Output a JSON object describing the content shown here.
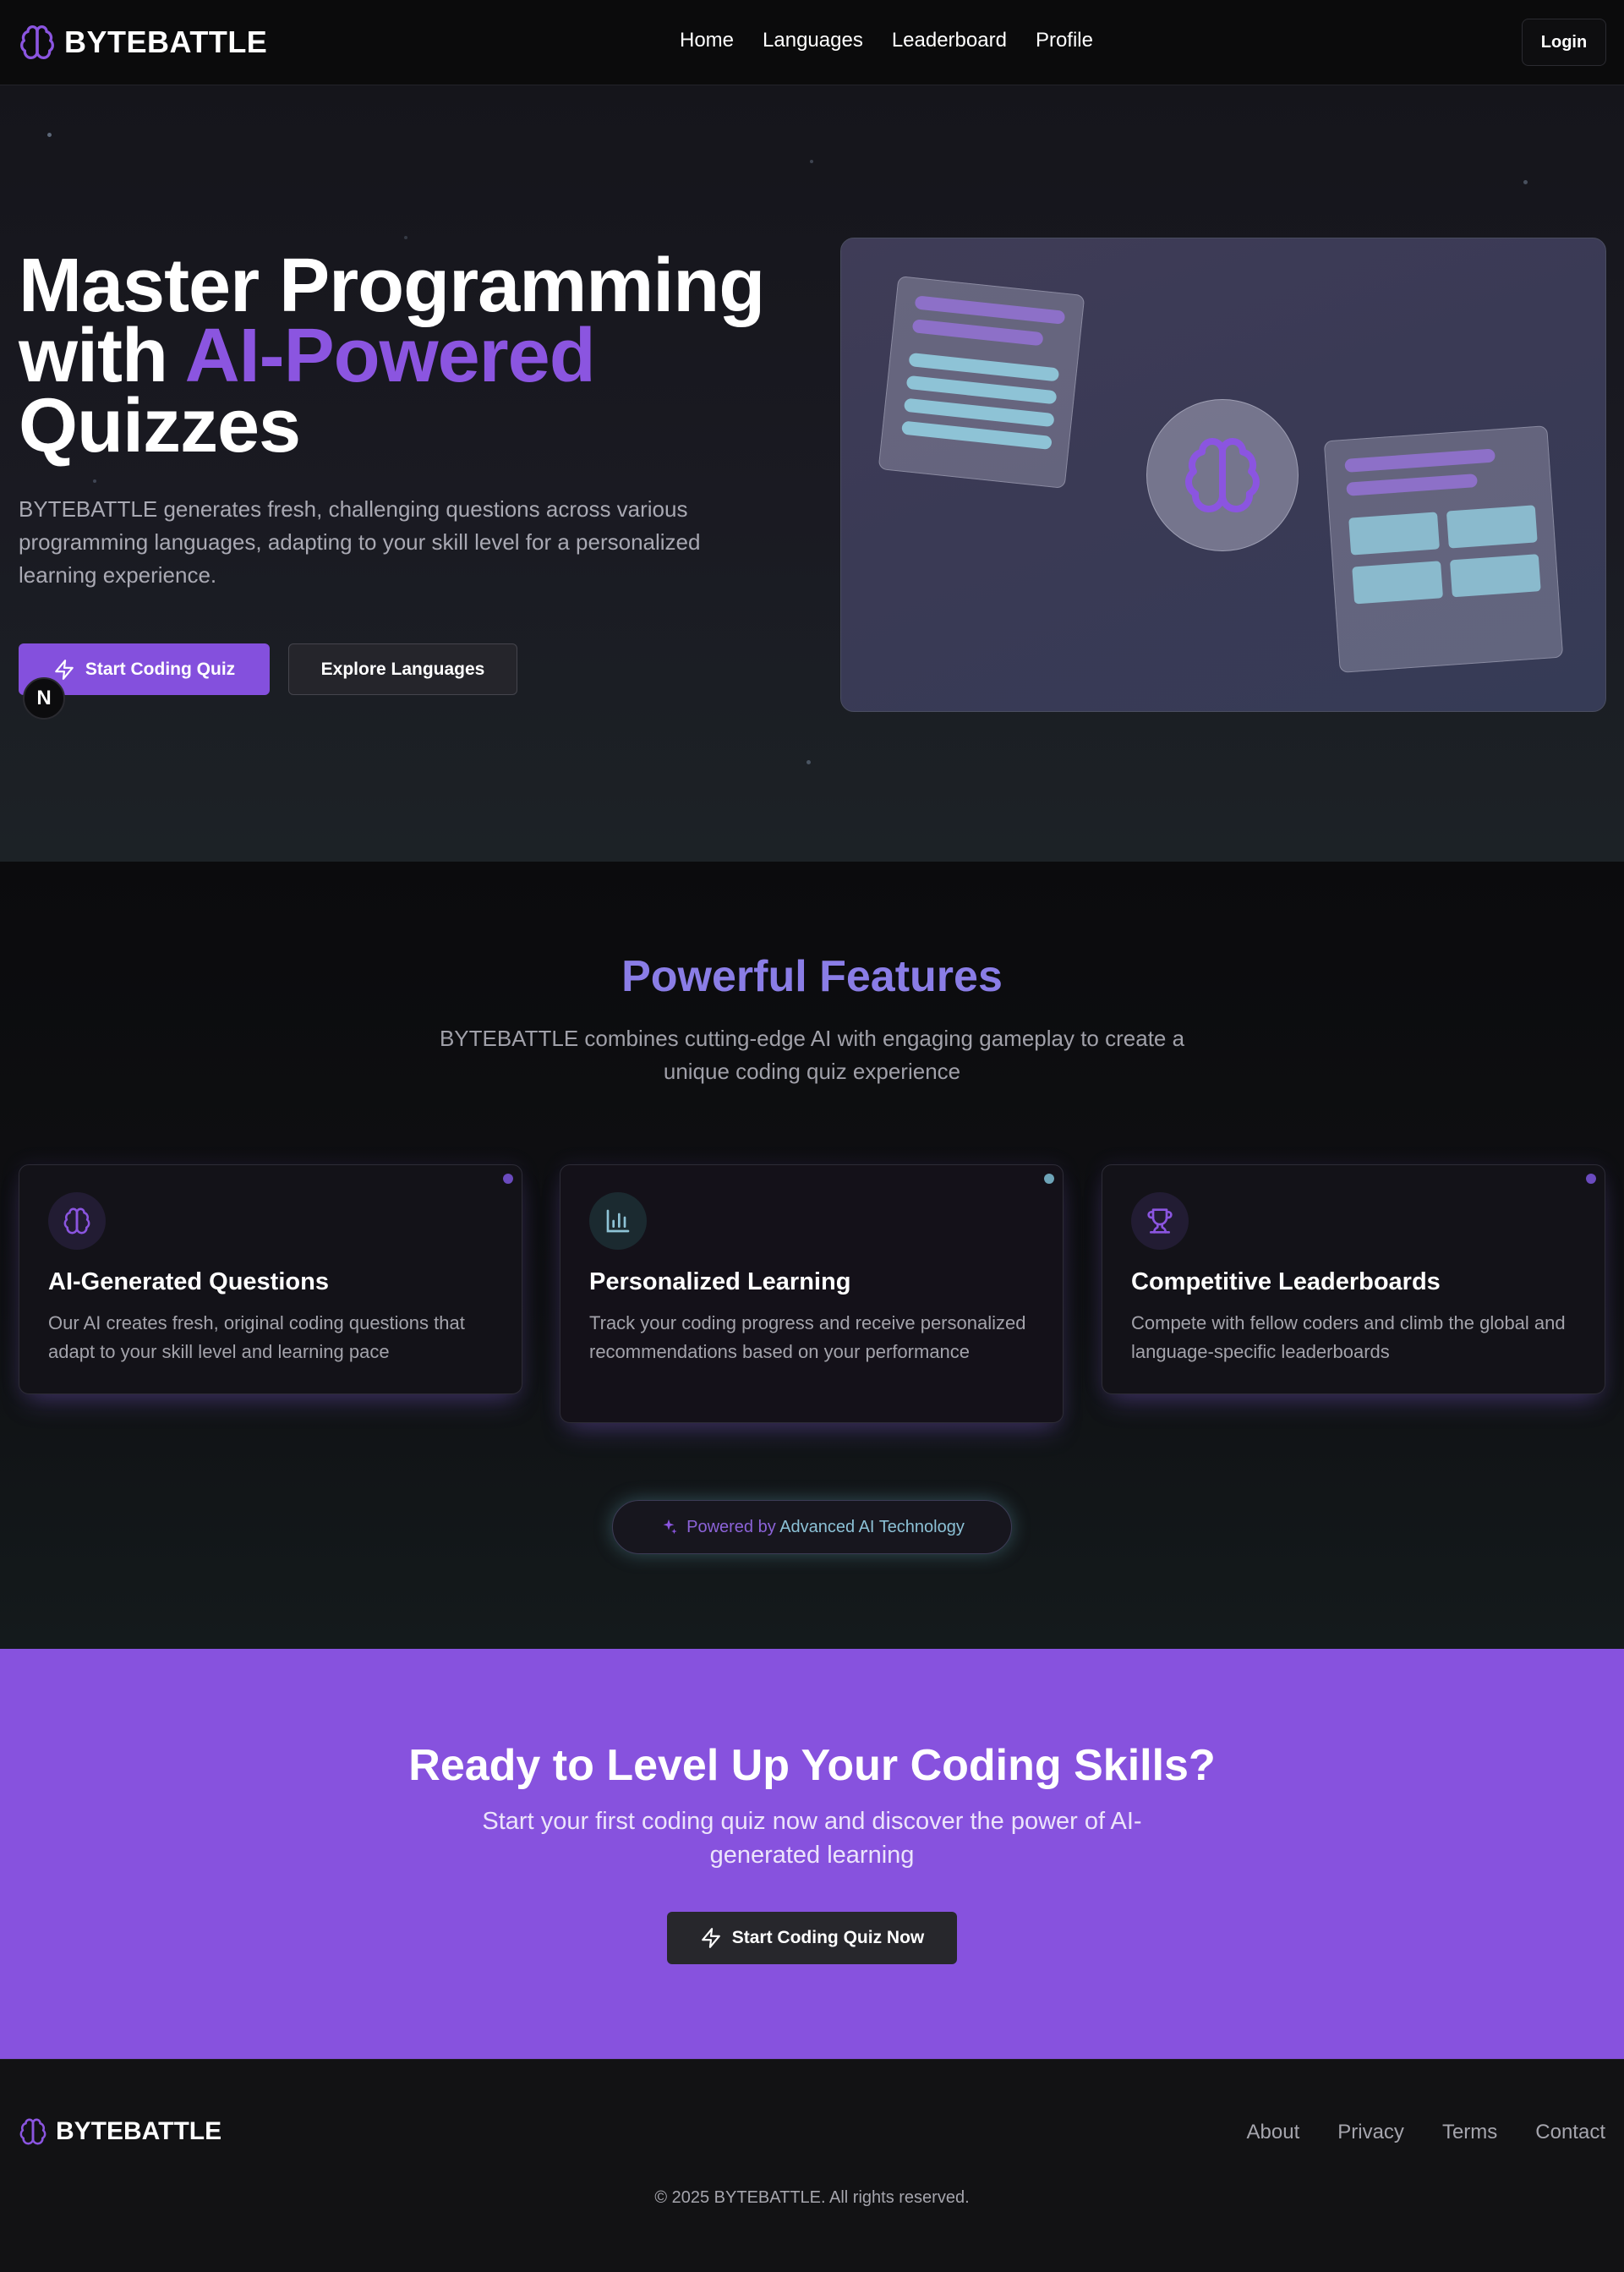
{
  "nav": {
    "brand": "BYTEBATTLE",
    "links": [
      "Home",
      "Languages",
      "Leaderboard",
      "Profile"
    ],
    "login_label": "Login"
  },
  "hero": {
    "title_line1": "Master Programming",
    "title_with": "with ",
    "title_accent": "AI-Powered",
    "title_line3": "Quizzes",
    "description": "BYTEBATTLE generates fresh, challenging questions across various programming languages, adapting to your skill level for a personalized learning experience.",
    "primary_button": "Start Coding Quiz",
    "secondary_button": "Explore Languages",
    "badge": "N"
  },
  "features": {
    "title": "Powerful Features",
    "subtitle": "BYTEBATTLE combines cutting-edge AI with engaging gameplay to create a unique coding quiz experience",
    "cards": [
      {
        "icon": "brain-icon",
        "title": "AI-Generated Questions",
        "description": "Our AI creates fresh, original coding questions that adapt to your skill level and learning pace"
      },
      {
        "icon": "bar-chart-icon",
        "title": "Personalized Learning",
        "description": "Track your coding progress and receive personalized recommendations based on your performance"
      },
      {
        "icon": "trophy-icon",
        "title": "Competitive Leaderboards",
        "description": "Compete with fellow coders and climb the global and language-specific leaderboards"
      }
    ],
    "powered_prefix": "Powered by ",
    "powered_suffix": "Advanced AI Technology"
  },
  "cta": {
    "title": "Ready to Level Up Your Coding Skills?",
    "subtitle": "Start your first coding quiz now and discover the power of AI-generated learning",
    "button": "Start Coding Quiz Now"
  },
  "footer": {
    "brand": "BYTEBATTLE",
    "links": [
      "About",
      "Privacy",
      "Terms",
      "Contact"
    ],
    "copyright": "© 2025 BYTEBATTLE. All rights reserved."
  },
  "colors": {
    "accent_purple": "#8752de",
    "accent_cyan": "#8ec3d6",
    "background": "#0b0b0d"
  }
}
